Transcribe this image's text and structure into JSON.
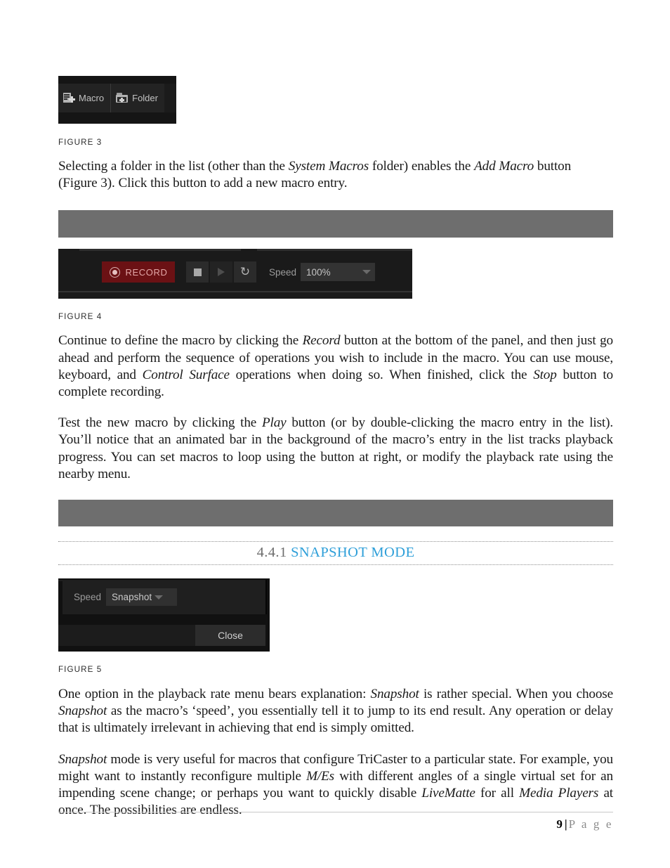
{
  "figure3": {
    "buttons": [
      {
        "icon": "add-macro-icon",
        "label": "Macro"
      },
      {
        "icon": "add-folder-icon",
        "label": "Folder"
      }
    ],
    "caption": "FIGURE 3"
  },
  "paragraph1": {
    "segments": [
      {
        "text": "Selecting a folder in the list (other than the ",
        "style": "normal"
      },
      {
        "text": "System Macros",
        "style": "italic"
      },
      {
        "text": " folder) enables the ",
        "style": "normal"
      },
      {
        "text": "Add Macro",
        "style": "italic"
      },
      {
        "text": " button (Figure 3). Click this button to add a new macro entry.",
        "style": "normal"
      }
    ]
  },
  "gray_bar_1": {
    "label": "image-placeholder"
  },
  "figure4": {
    "record_label": "RECORD",
    "record_icon": "record-dot-icon",
    "stop_icon": "stop-icon",
    "play_icon": "play-icon",
    "loop_icon": "loop-icon",
    "loop_glyph": "↻",
    "speed_label": "Speed",
    "speed_value": "100%",
    "caption": "FIGURE 4"
  },
  "paragraph2": {
    "segments": [
      {
        "text": "Continue to define the macro by clicking the ",
        "style": "normal"
      },
      {
        "text": "Record",
        "style": "italic"
      },
      {
        "text": " button at the bottom of the panel, and then just go ahead and perform the sequence of operations you wish to include in the macro.  You can use mouse, keyboard, and ",
        "style": "normal"
      },
      {
        "text": "Control Surface",
        "style": "italic"
      },
      {
        "text": " operations when doing so.  When finished, click the ",
        "style": "normal"
      },
      {
        "text": "Stop",
        "style": "italic"
      },
      {
        "text": " button to complete recording.",
        "style": "normal"
      }
    ]
  },
  "paragraph3": {
    "segments": [
      {
        "text": "Test the new macro by clicking the ",
        "style": "normal"
      },
      {
        "text": "Play",
        "style": "italic"
      },
      {
        "text": " button (or by double-clicking the macro entry in the list).  You’ll notice that an animated bar in the background of the macro’s entry in the list tracks playback progress. You can set macros to loop using the button at right, or modify the playback rate using the nearby menu.",
        "style": "normal"
      }
    ]
  },
  "gray_bar_2": {
    "label": "image-placeholder"
  },
  "heading": {
    "number": "4.4.1",
    "title": "SNAPSHOT MODE"
  },
  "figure5": {
    "speed_label": "Speed",
    "speed_value": "Snapshot",
    "close_label": "Close",
    "caption": "FIGURE 5"
  },
  "paragraph4": {
    "segments": [
      {
        "text": "One option in the playback rate menu bears explanation: ",
        "style": "normal"
      },
      {
        "text": "Snapshot",
        "style": "italic"
      },
      {
        "text": " is rather special.  When you choose ",
        "style": "normal"
      },
      {
        "text": "Snapshot",
        "style": "italic"
      },
      {
        "text": " as the macro’s ‘speed’, you essentially tell it to jump to its end result.  Any operation or delay that is ultimately irrelevant in achieving that end is simply omitted.",
        "style": "normal"
      }
    ]
  },
  "paragraph5": {
    "segments": [
      {
        "text": "Snapshot",
        "style": "italic"
      },
      {
        "text": " mode is very useful for macros that configure TriCaster to a particular state.  For example, you might want to instantly reconfigure multiple ",
        "style": "normal"
      },
      {
        "text": "M/Es",
        "style": "italic"
      },
      {
        "text": " with different angles of a single virtual set for an impending scene change; or perhaps you want to quickly disable ",
        "style": "normal"
      },
      {
        "text": "LiveMatte",
        "style": "italic"
      },
      {
        "text": " for all ",
        "style": "normal"
      },
      {
        "text": "Media Players",
        "style": "italic"
      },
      {
        "text": " at once. The possibilities are endless.",
        "style": "normal"
      }
    ]
  },
  "footer": {
    "page_number": "9",
    "separator": "|",
    "page_word": "P a g e"
  },
  "colors": {
    "heading_blue": "#2e9fd9",
    "heading_gray": "#6d6d6d",
    "gray_bar": "#6e6e6e",
    "record_red": "#6b1114",
    "panel_dark": "#1a1a1a"
  }
}
